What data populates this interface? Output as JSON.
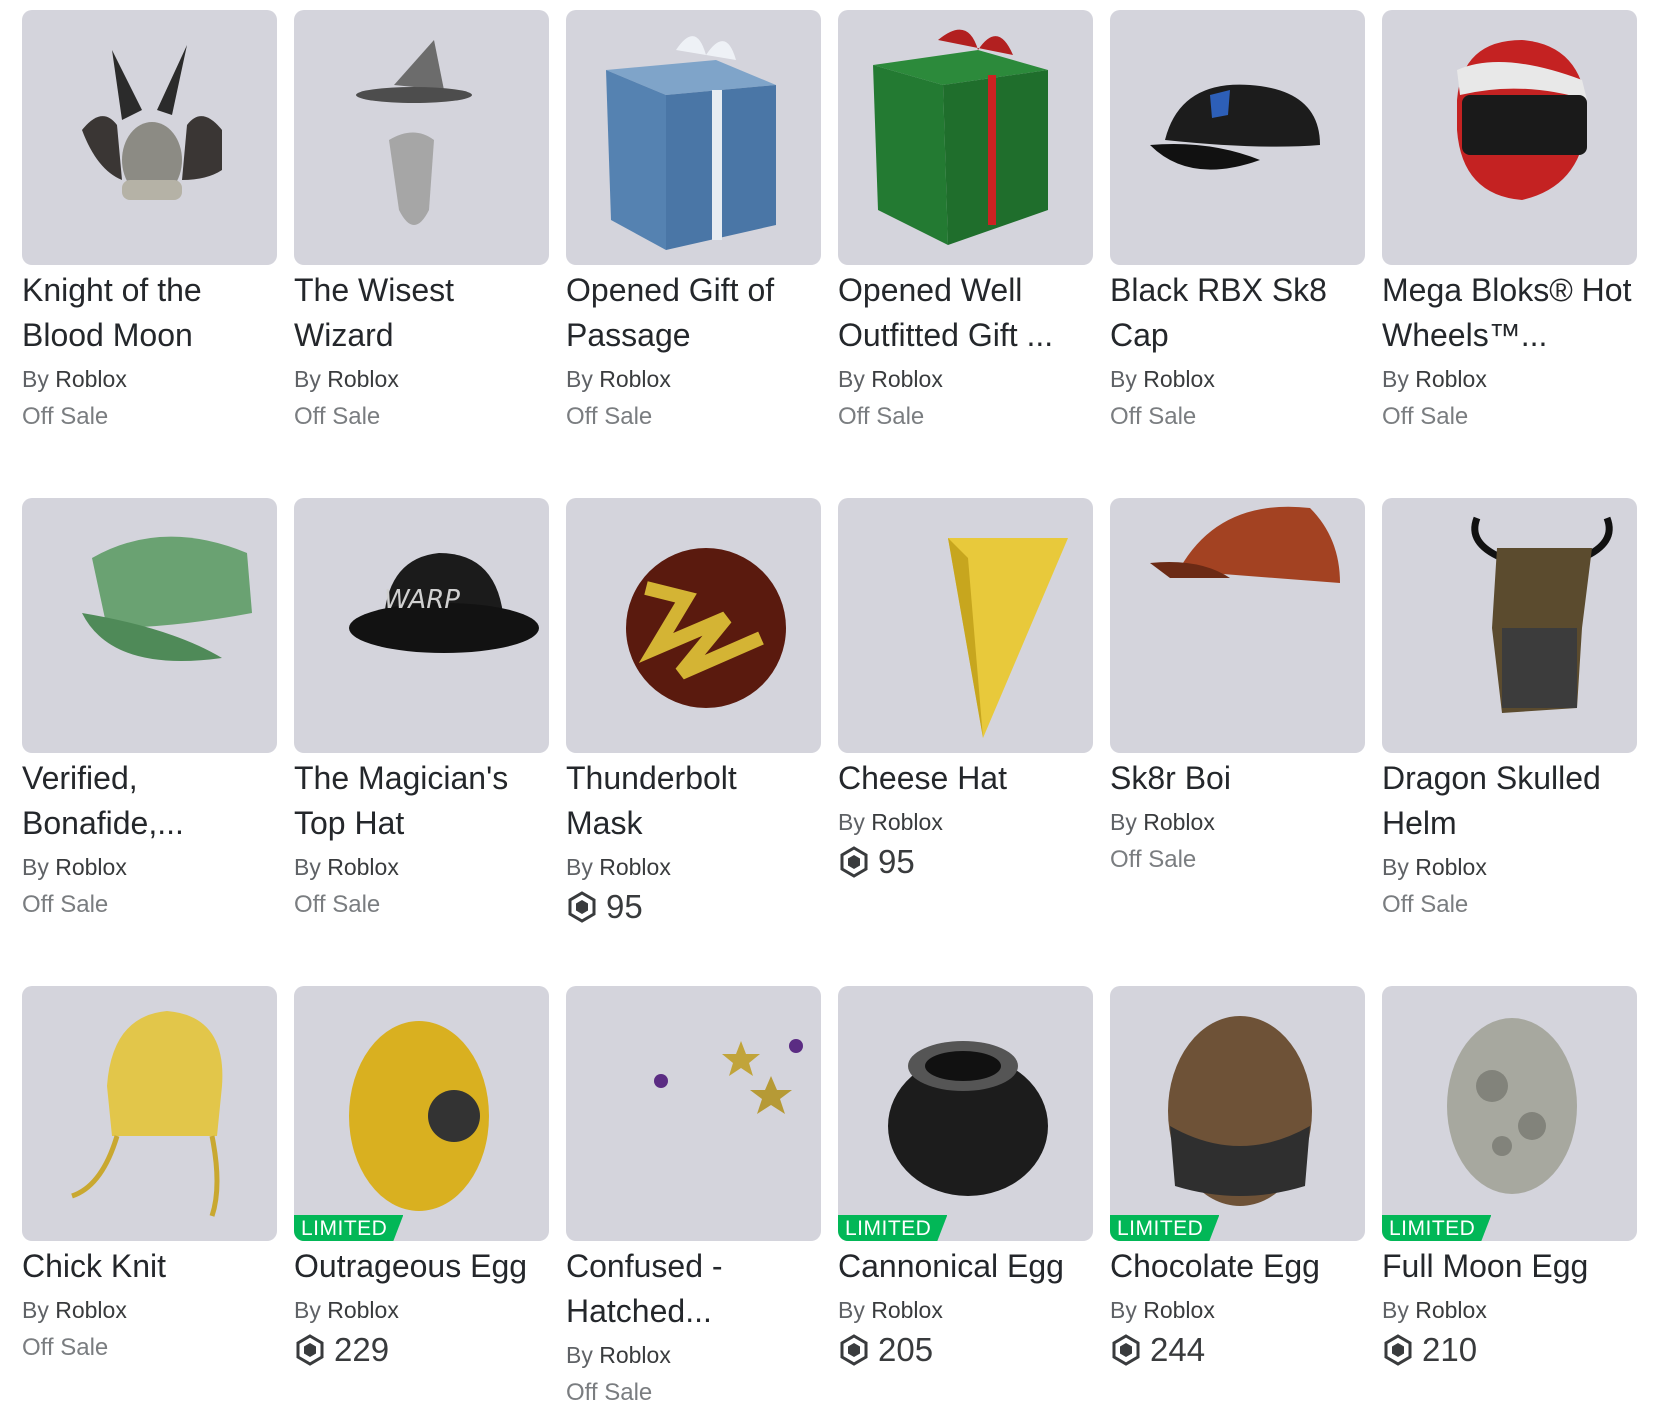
{
  "labels": {
    "by": "By",
    "limited": "LIMITED"
  },
  "items": [
    {
      "name": "Knight of the Blood Moon",
      "creator": "Roblox",
      "status": "Off Sale"
    },
    {
      "name": "The Wisest Wizard",
      "creator": "Roblox",
      "status": "Off Sale"
    },
    {
      "name": "Opened Gift of Passage",
      "creator": "Roblox",
      "status": "Off Sale"
    },
    {
      "name": "Opened Well Outfitted Gift ...",
      "creator": "Roblox",
      "status": "Off Sale"
    },
    {
      "name": "Black RBX Sk8 Cap",
      "creator": "Roblox",
      "status": "Off Sale"
    },
    {
      "name": "Mega Bloks® Hot Wheels™...",
      "creator": "Roblox",
      "status": "Off Sale"
    },
    {
      "name": "Verified, Bonafide,...",
      "creator": "Roblox",
      "status": "Off Sale"
    },
    {
      "name": "The Magician's Top Hat",
      "creator": "Roblox",
      "status": "Off Sale"
    },
    {
      "name": "Thunderbolt Mask",
      "creator": "Roblox",
      "price": "95"
    },
    {
      "name": "Cheese Hat",
      "creator": "Roblox",
      "price": "95"
    },
    {
      "name": "Sk8r Boi",
      "creator": "Roblox",
      "status": "Off Sale"
    },
    {
      "name": "Dragon Skulled Helm",
      "creator": "Roblox",
      "status": "Off Sale"
    },
    {
      "name": "Chick Knit",
      "creator": "Roblox",
      "status": "Off Sale"
    },
    {
      "name": "Outrageous Egg",
      "creator": "Roblox",
      "price": "229",
      "limited": true
    },
    {
      "name": "Confused - Hatched...",
      "creator": "Roblox",
      "status": "Off Sale"
    },
    {
      "name": "Cannonical Egg",
      "creator": "Roblox",
      "price": "205",
      "limited": true
    },
    {
      "name": "Chocolate Egg",
      "creator": "Roblox",
      "price": "244",
      "limited": true
    },
    {
      "name": "Full Moon Egg",
      "creator": "Roblox",
      "price": "210",
      "limited": true
    }
  ]
}
